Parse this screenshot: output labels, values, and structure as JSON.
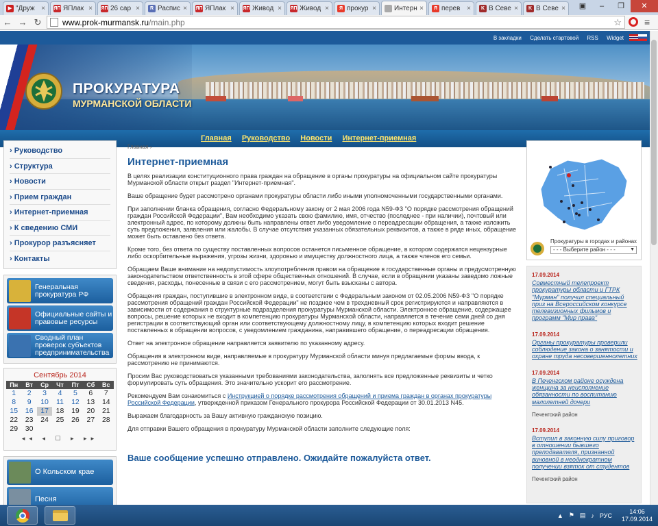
{
  "browser": {
    "tabs": [
      {
        "label": "\"Друж",
        "fav_color": "#cc1f1f",
        "fav": "▶"
      },
      {
        "label": "ЯПлак",
        "fav_color": "#c8282b",
        "fav": "ЯП"
      },
      {
        "label": "26 сар",
        "fav_color": "#c8282b",
        "fav": "ЯП"
      },
      {
        "label": "Распис",
        "fav_color": "#5a6fb5",
        "fav": "R"
      },
      {
        "label": "ЯПлак",
        "fav_color": "#c8282b",
        "fav": "ЯП"
      },
      {
        "label": "Живод",
        "fav_color": "#c8282b",
        "fav": "ЯП"
      },
      {
        "label": "Живод",
        "fav_color": "#c8282b",
        "fav": "ЯП"
      },
      {
        "label": "прокур",
        "fav_color": "#e83a2a",
        "fav": "Я"
      },
      {
        "label": "Интерн",
        "fav_color": "#aaaaaa",
        "fav": "",
        "active": true
      },
      {
        "label": "перев",
        "fav_color": "#e83a2a",
        "fav": "Я"
      },
      {
        "label": "В Севе",
        "fav_color": "#a02b2b",
        "fav": "K"
      },
      {
        "label": "В Севе",
        "fav_color": "#a02b2b",
        "fav": "K"
      }
    ],
    "url_host": "www.prok-murmansk.ru",
    "url_path": "/main.php"
  },
  "site": {
    "top_links": [
      "В закладки",
      "Сделать стартовой",
      "RSS",
      "Widget"
    ],
    "logo_title": "ПРОКУРАТУРА",
    "logo_sub": "МУРМАНСКОЙ ОБЛАСТИ",
    "main_nav": [
      "Главная",
      "Руководство",
      "Новости",
      "Интернет-приемная"
    ]
  },
  "left_menu": [
    "Руководство",
    "Структура",
    "Новости",
    "Прием граждан",
    "Интернет-приемная",
    "К сведению СМИ",
    "Прокурор разъясняет",
    "Контакты"
  ],
  "promo": [
    {
      "label": "Генеральная прокуратура РФ",
      "color": "#d8b23a"
    },
    {
      "label": "Официальные сайты и правовые ресурсы",
      "color": "#c53527"
    },
    {
      "label": "Сводный план проверок субъектов предпринимательства",
      "color": "#3a72b0"
    }
  ],
  "calendar": {
    "title": "Сентябрь 2014",
    "days_header": [
      "Пн",
      "Вт",
      "Ср",
      "Чт",
      "Пт",
      "Сб",
      "Вс"
    ],
    "weeks": [
      [
        "1",
        "2",
        "3",
        "4",
        "5",
        "6",
        "7"
      ],
      [
        "8",
        "9",
        "10",
        "11",
        "12",
        "13",
        "14"
      ],
      [
        "15",
        "16",
        "17",
        "18",
        "19",
        "20",
        "21"
      ],
      [
        "22",
        "23",
        "24",
        "25",
        "26",
        "27",
        "28"
      ],
      [
        "29",
        "30",
        "",
        "",
        "",
        "",
        ""
      ]
    ],
    "linked_until": "17",
    "today": "17",
    "nav": "◂◂ ◂ ☐ ▸ ▸▸"
  },
  "promo2": [
    {
      "label": "О Кольском крае",
      "color": "#6b8a5a"
    },
    {
      "label": "Песня",
      "color": "#7a8fa0"
    }
  ],
  "content": {
    "breadcrumb": "Главная",
    "breadcrumb_sep": "›",
    "title": "Интернет-приемная",
    "paragraphs": [
      "В целях реализации конституционного права граждан на обращение в органы прокуратуры на официальном сайте прокуратуры Мурманской области открыт раздел \"Интернет-приемная\".",
      "Ваше обращение будет рассмотрено органами прокуратуры области либо иными уполномоченными государственными органами.",
      "При заполнении бланка обращения, согласно Федеральному закону от 2 мая 2006 года N59-ФЗ \"О порядке рассмотрения обращений граждан Российской Федерации\", Вам необходимо указать свою фамилию, имя, отчество (последнее - при наличии), почтовый или электронный адрес, по которому должны быть направлены ответ либо уведомление о переадресации обращения, а также изложить суть предложения, заявления или жалобы. В случае отсутствия указанных обязательных реквизитов, а также в ряде иных, обращение может быть оставлено без ответа.",
      "Кроме того, без ответа по существу поставленных вопросов останется письменное обращение, в котором содержатся нецензурные либо оскорбительные выражения, угрозы жизни, здоровью и имуществу должностного лица, а также членов его семьи.",
      "Обращаем Ваше внимание на недопустимость злоупотребления правом на обращение в государственные органы и предусмотренную законодательством ответственность в этой сфере общественных отношений. В случае, если в обращении указаны заведомо ложные сведения, расходы, понесенные в связи с его рассмотрением, могут быть взысканы с автора.",
      "Обращения граждан, поступившие в электронном виде, в соответствии с Федеральным законом от 02.05.2006 N59-ФЗ \"О порядке рассмотрения обращений граждан Российской Федерации\" не позднее чем в трехдневный срок регистрируются и направляются в зависимости от содержания в структурные подразделения прокуратуры Мурманской области. Электронное обращение, содержащее вопросы, решение которых не входит в компетенцию прокуратуры Мурманской области, направляется в течение семи дней со дня регистрации в соответствующий орган или соответствующему должностному лицу, в компетенцию которых входит решение поставленных в обращении вопросов, с уведомлением гражданина, направившего обращение, о переадресации обращения.",
      "Ответ на электронное обращение направляется заявителю по указанному адресу.",
      "Обращения в электронном виде, направляемые в прокуратуру Мурманской области минуя предлагаемые формы ввода, к рассмотрению не принимаются.",
      "Просим Вас руководствоваться указанными требованиями законодательства, заполнять все предложенные реквизиты и четко формулировать суть обращения. Это значительно ускорит его рассмотрение."
    ],
    "instr_before": "Рекомендуем Вам ознакомиться с ",
    "instr_link": "Инструкцией о порядке рассмотрения обращений и приема граждан в органах прокуратуры Российской Федерации",
    "instr_after": ", утвержденной приказом Генерального прокурора Российской Федерации от 30.01.2013 N45.",
    "thanks": "Выражаем благодарность за Вашу активную гражданскую позицию.",
    "form_intro": "Для отправки Вашего обращения в прокуратуру Мурманской области заполните следующие поля:",
    "success": "Ваше сообщение успешно отправлено. Ожидайте пожалуйста ответ."
  },
  "map": {
    "caption": "Прокуратуры в городах и районах",
    "select_value": "- - - Выберите район - - -"
  },
  "news": [
    {
      "date": "17.09.2014",
      "text": "Совместный телепроект прокуратуры области и ГТРК \"Мурман\" получил специальный приз на Всероссийском конкурсе телевизионных фильмов и программ \"Мир права\"",
      "loc": ""
    },
    {
      "date": "17.09.2014",
      "text": "Органы прокуратуры проверили соблюдение закона о занятости и охране труда несовершеннолетних",
      "loc": ""
    },
    {
      "date": "17.09.2014",
      "text": "В Печенгском районе осуждена женщина за неисполнение обязанности по воспитанию малолетней дочери",
      "loc": "Печенгский район"
    },
    {
      "date": "17.09.2014",
      "text": "Вступил в законную силу приговор в отношении бывшего преподавателя, признанной виновной в неоднократном получении взяток от студентов",
      "loc": "Печенгский район"
    }
  ],
  "taskbar": {
    "lang": "РУС",
    "time": "14:06",
    "date": "17.09.2014"
  }
}
